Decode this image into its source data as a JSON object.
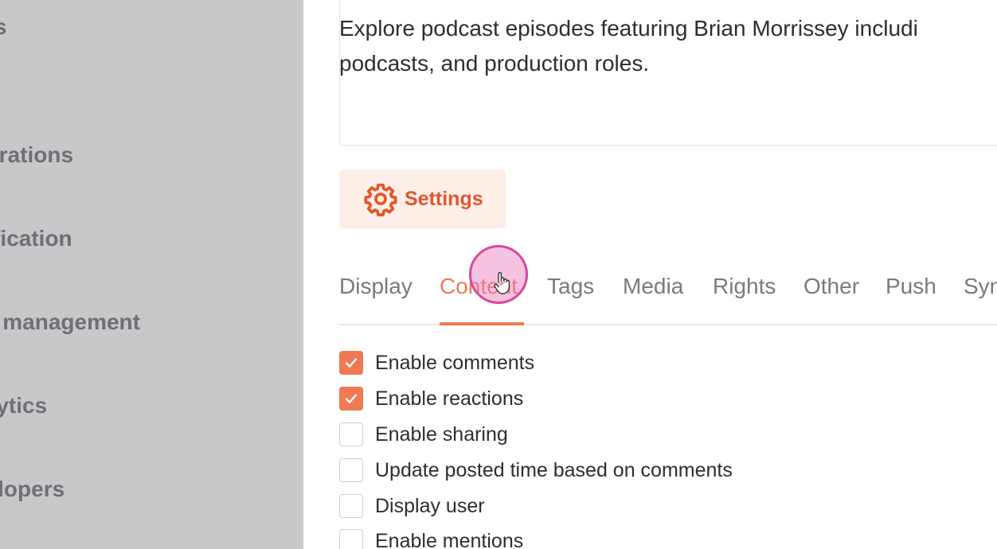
{
  "sidebar": {
    "items": [
      {
        "label": "ats"
      },
      {
        "label": "egrations"
      },
      {
        "label": "tification"
      },
      {
        "label": "er management"
      },
      {
        "label": "alytics"
      },
      {
        "label": "velopers"
      }
    ]
  },
  "description": {
    "line1": "Explore podcast episodes featuring Brian Morrissey includi",
    "line2": "podcasts, and production roles."
  },
  "settings_button": {
    "label": "Settings",
    "icon": "gear-icon"
  },
  "tabs": [
    {
      "label": "Display",
      "active": false
    },
    {
      "label": "Content",
      "active": true
    },
    {
      "label": "Tags",
      "active": false
    },
    {
      "label": "Media",
      "active": false
    },
    {
      "label": "Rights",
      "active": false
    },
    {
      "label": "Other",
      "active": false
    },
    {
      "label": "Push",
      "active": false
    },
    {
      "label": "Syn",
      "active": false
    }
  ],
  "options": [
    {
      "label": "Enable comments",
      "checked": true
    },
    {
      "label": "Enable reactions",
      "checked": true
    },
    {
      "label": "Enable sharing",
      "checked": false
    },
    {
      "label": "Update posted time based on comments",
      "checked": false
    },
    {
      "label": "Display user",
      "checked": false
    },
    {
      "label": "Enable mentions",
      "checked": false
    }
  ],
  "colors": {
    "accent": "#ef7a52",
    "settings_text": "#e2572b",
    "settings_bg": "#fdeee8",
    "sidebar_bg": "#c8c8ca",
    "cursor_highlight": "#d9489a"
  }
}
